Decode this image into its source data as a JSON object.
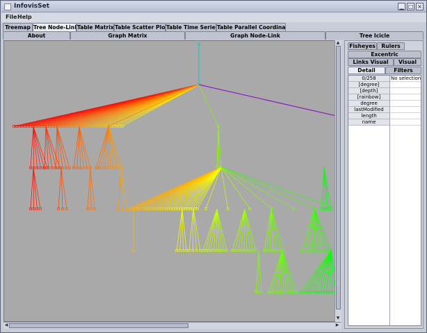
{
  "window": {
    "title": "InfovisSet",
    "controls": [
      "minimize",
      "maximize",
      "close"
    ]
  },
  "menu": [
    "File",
    "Help"
  ],
  "tabs_row1": [
    {
      "label": "Treemap",
      "active": false
    },
    {
      "label": "Tree Node-Link",
      "active": true
    },
    {
      "label": "Table Matrix",
      "active": false
    },
    {
      "label": "Table Scatter Plot",
      "active": false
    },
    {
      "label": "Table Time Series",
      "active": false
    },
    {
      "label": "Table Parallel Coordinates",
      "active": false
    }
  ],
  "tabs_row2": [
    "About",
    "Graph Matrix",
    "Graph Node-Link",
    "Tree Icicle"
  ],
  "panel": {
    "tabs_row1": [
      "Fisheyes",
      "Rulers"
    ],
    "tabs_row2": [
      "Excentric"
    ],
    "tabs_row3": [
      "Links Visual",
      "Visual"
    ],
    "tabs_row4": [
      {
        "label": "Detail",
        "active": true
      },
      {
        "label": "Filters",
        "active": false
      }
    ],
    "table_header": [
      "0/258",
      "No selection"
    ],
    "rows": [
      "[degree]",
      "[depth]",
      "[rainbow]",
      "degree",
      "lastModified",
      "length",
      "name"
    ]
  },
  "colors": {
    "canvas_background": "#a9a9a9",
    "root_link": "#00cccc",
    "purple_link": "#8800cc"
  },
  "icons": {
    "app": "window-icon",
    "scroll_up": "arrow-up-icon",
    "scroll_down": "arrow-down-icon",
    "scroll_left": "arrow-left-icon",
    "scroll_right": "arrow-right-icon"
  }
}
